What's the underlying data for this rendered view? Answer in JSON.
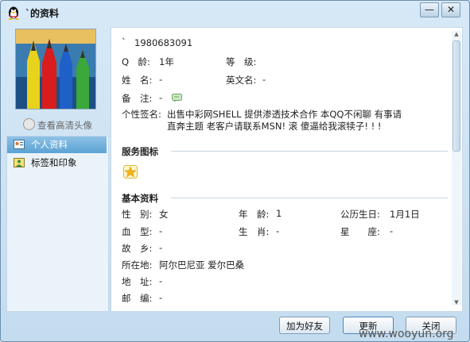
{
  "window": {
    "title": "`的资料",
    "min_symbol": "—",
    "close_symbol": "✕"
  },
  "sidebar": {
    "hd_avatar_link": "查看高清头像",
    "items": [
      {
        "label": "个人资料",
        "icon": "id-card-icon",
        "active": true
      },
      {
        "label": "标签和印象",
        "icon": "tag-person-icon",
        "active": false
      }
    ]
  },
  "profile": {
    "nickname": "`",
    "qq_number": "1980683091",
    "q_age_label": "Q　龄:",
    "q_age_value": "1年",
    "level_label": "等　级:",
    "name_label": "姓　名:",
    "name_value": "-",
    "english_name_label": "英文名:",
    "english_name_value": "-",
    "remark_label": "备　注:",
    "remark_value": "-",
    "signature_label": "个性签名:",
    "signature_line1": "出售中彩网SHELL 提供渗透技术合作 本QQ不闲聊 有事请",
    "signature_line2": "直奔主题  老客户请联系MSN! 滚 傻逼给我滚犊子! ! !"
  },
  "service_section": {
    "title": "服务图标",
    "icon": "star-badge-icon"
  },
  "basic_section": {
    "title": "基本资料",
    "gender_label": "性　别:",
    "gender_value": "女",
    "age_label": "年　龄:",
    "age_value": "1",
    "birthday_label": "公历生日:",
    "birthday_value": "1月1日",
    "blood_label": "血　型:",
    "blood_value": "-",
    "zodiac_label": "生　肖:",
    "zodiac_value": "-",
    "constellation_label": "星　　座:",
    "constellation_value": "-",
    "hometown_label": "故　乡:",
    "hometown_value": "-",
    "location_label": "所在地:",
    "location_value": "阿尔巴尼亚 爱尔巴桑",
    "address_label": "地　址:",
    "address_value": "-",
    "postcode_label": "邮　编:",
    "postcode_value": "-"
  },
  "footer": {
    "add_friend": "加为好友",
    "refresh": "更新",
    "close": "关闭"
  },
  "watermark": "www.wooyun.org"
}
